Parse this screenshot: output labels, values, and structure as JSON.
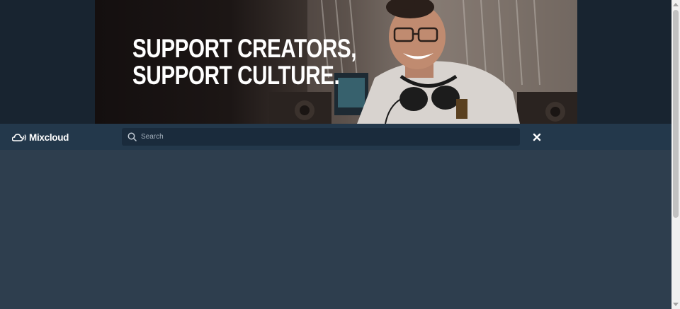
{
  "banner": {
    "headline_line1": "SUPPORT CREATORS,",
    "headline_line2": "SUPPORT CULTURE."
  },
  "navbar": {
    "logo_text": "Mixcloud",
    "logo_icon": "cloud-waves-icon",
    "search": {
      "placeholder": "Search",
      "value": ""
    },
    "close_icon": "close-icon"
  },
  "colors": {
    "page_background": "#2e3e4e",
    "navbar_background": "#23384b",
    "search_background": "#1a2b3c",
    "banner_row_background": "#182430",
    "text": "#ffffff"
  }
}
